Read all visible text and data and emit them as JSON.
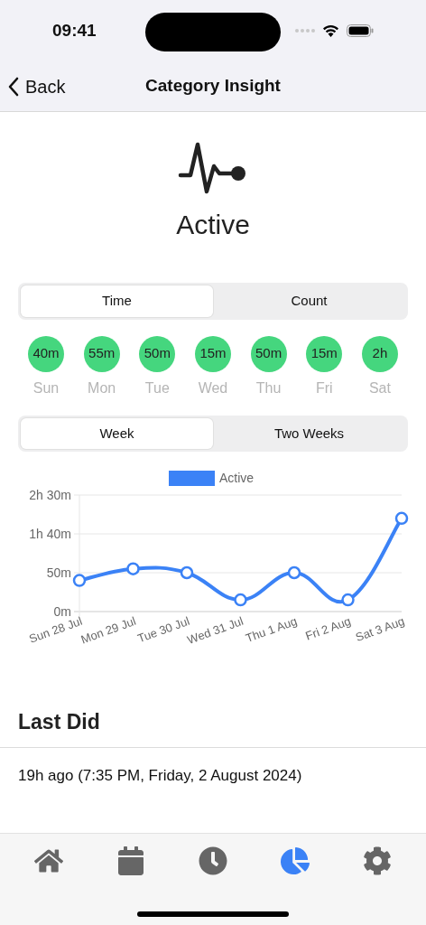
{
  "status_bar": {
    "time": "09:41"
  },
  "nav": {
    "back": "Back",
    "title": "Category Insight"
  },
  "category": {
    "name": "Active"
  },
  "metric_toggle": [
    {
      "label": "Time",
      "selected": true
    },
    {
      "label": "Count",
      "selected": false
    }
  ],
  "days": [
    {
      "value": "40m",
      "day": "Sun"
    },
    {
      "value": "55m",
      "day": "Mon"
    },
    {
      "value": "50m",
      "day": "Tue"
    },
    {
      "value": "15m",
      "day": "Wed"
    },
    {
      "value": "50m",
      "day": "Thu"
    },
    {
      "value": "15m",
      "day": "Fri"
    },
    {
      "value": "2h",
      "day": "Sat"
    }
  ],
  "range_toggle": [
    {
      "label": "Week",
      "selected": true
    },
    {
      "label": "Two Weeks",
      "selected": false
    }
  ],
  "chart_data": {
    "type": "line",
    "categories": [
      "Sun 28 Jul",
      "Mon 29 Jul",
      "Tue 30 Jul",
      "Wed 31 Jul",
      "Thu 1 Aug",
      "Fri 2 Aug",
      "Sat 3 Aug"
    ],
    "series": [
      {
        "name": "Active",
        "color": "#3b82f6",
        "marker": "circle",
        "values": [
          40,
          55,
          50,
          15,
          50,
          15,
          120
        ]
      }
    ],
    "ylim": [
      0,
      150
    ],
    "yticks": [
      {
        "value": 0,
        "label": "0m"
      },
      {
        "value": 50,
        "label": "50m"
      },
      {
        "value": 100,
        "label": "1h 40m"
      },
      {
        "value": 150,
        "label": "2h 30m"
      }
    ]
  },
  "last_did": {
    "heading": "Last Did",
    "text": "19h ago (7:35 PM, Friday, 2 August 2024)"
  },
  "tab_bar": [
    {
      "selected": false
    },
    {
      "selected": false
    },
    {
      "selected": false
    },
    {
      "selected": true
    },
    {
      "selected": false
    }
  ]
}
